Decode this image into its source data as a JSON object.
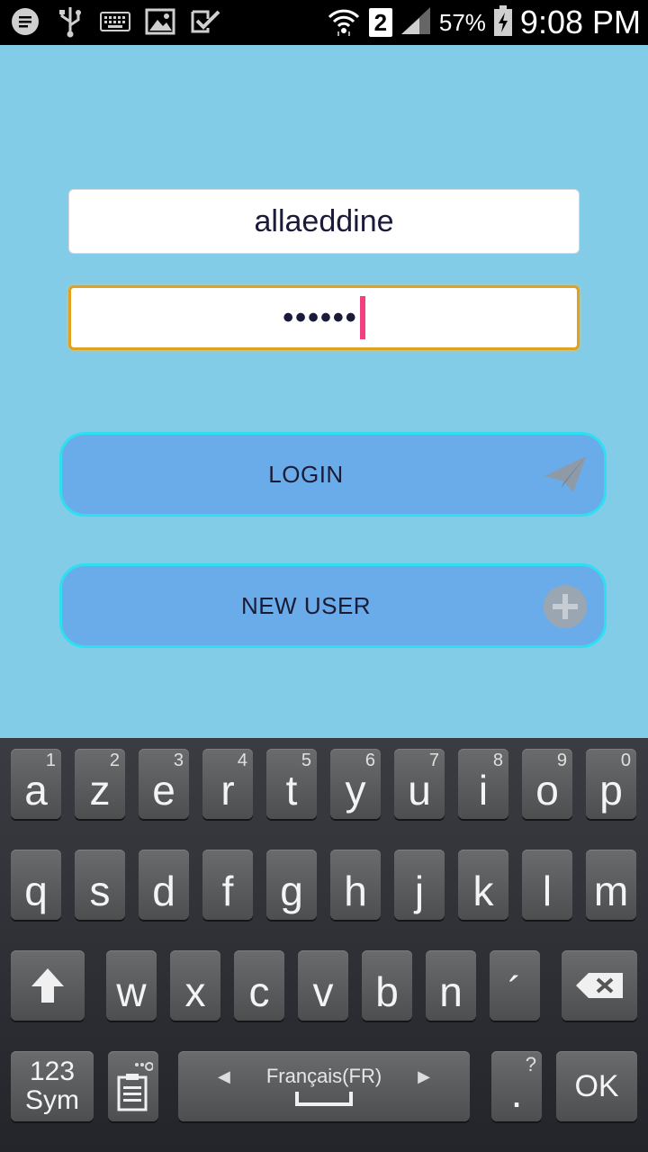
{
  "status_bar": {
    "left_icons": [
      "message-icon",
      "usb-icon",
      "keyboard-icon",
      "image-icon",
      "checkmark-icon"
    ],
    "sim_slot": "2",
    "battery_percent": "57%",
    "time": "9:08 PM"
  },
  "form": {
    "username_value": "allaeddine",
    "password_dots": "••••••"
  },
  "buttons": {
    "login_label": "LOGIN",
    "new_user_label": "NEW USER"
  },
  "keyboard": {
    "row1": [
      {
        "k": "a",
        "s": "1"
      },
      {
        "k": "z",
        "s": "2"
      },
      {
        "k": "e",
        "s": "3"
      },
      {
        "k": "r",
        "s": "4"
      },
      {
        "k": "t",
        "s": "5"
      },
      {
        "k": "y",
        "s": "6"
      },
      {
        "k": "u",
        "s": "7"
      },
      {
        "k": "i",
        "s": "8"
      },
      {
        "k": "o",
        "s": "9"
      },
      {
        "k": "p",
        "s": "0"
      }
    ],
    "row2": [
      "q",
      "s",
      "d",
      "f",
      "g",
      "h",
      "j",
      "k",
      "l",
      "m"
    ],
    "row3": [
      "w",
      "x",
      "c",
      "v",
      "b",
      "n",
      "´"
    ],
    "sym_line1": "123",
    "sym_line2": "Sym",
    "language": "Français(FR)",
    "period_label": ".",
    "period_sup": "?",
    "ok_label": "OK"
  },
  "colors": {
    "app_background": "#83cce8",
    "button_fill": "#6aabe9",
    "button_border": "#2de0f0",
    "focus_border": "#e0a020",
    "cursor": "#f0407f"
  }
}
